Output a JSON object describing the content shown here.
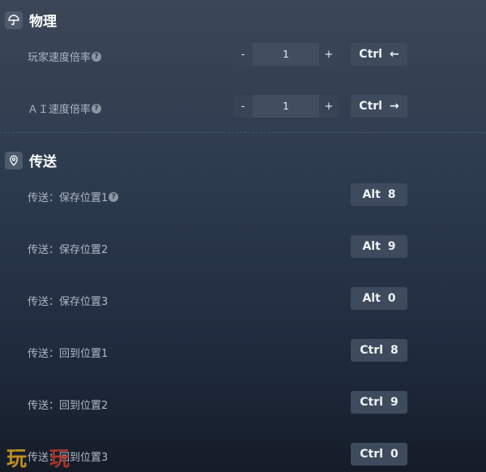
{
  "physics": {
    "title": "物理",
    "icon": "umbrella-icon",
    "rows": [
      {
        "label": "玩家速度倍率",
        "value": "1",
        "minus": "-",
        "plus": "+",
        "key_mod": "Ctrl",
        "key_main": "←"
      },
      {
        "label": "ＡＩ速度倍率",
        "value": "1",
        "minus": "-",
        "plus": "+",
        "key_mod": "Ctrl",
        "key_main": "→"
      }
    ]
  },
  "teleport": {
    "title": "传送",
    "icon": "location-pin-icon",
    "rows": [
      {
        "label": "传送：保存位置1",
        "key_mod": "Alt",
        "key_main": "8"
      },
      {
        "label": "传送：保存位置2",
        "key_mod": "Alt",
        "key_main": "9"
      },
      {
        "label": "传送：保存位置3",
        "key_mod": "Alt",
        "key_main": "0"
      },
      {
        "label": "传送：回到位置1",
        "key_mod": "Ctrl",
        "key_main": "8"
      },
      {
        "label": "传送：回到位置2",
        "key_mod": "Ctrl",
        "key_main": "9"
      },
      {
        "label": "传送：回到位置3",
        "key_mod": "Ctrl",
        "key_main": "0"
      }
    ]
  },
  "help_glyph": "?",
  "watermark": {
    "left": "玩",
    "right": "玩"
  },
  "colors": {
    "accent_white": "#ffffff",
    "button_bg": "#3e4b5d",
    "watermark_left": "#d9a520",
    "watermark_right": "#c0392b"
  }
}
